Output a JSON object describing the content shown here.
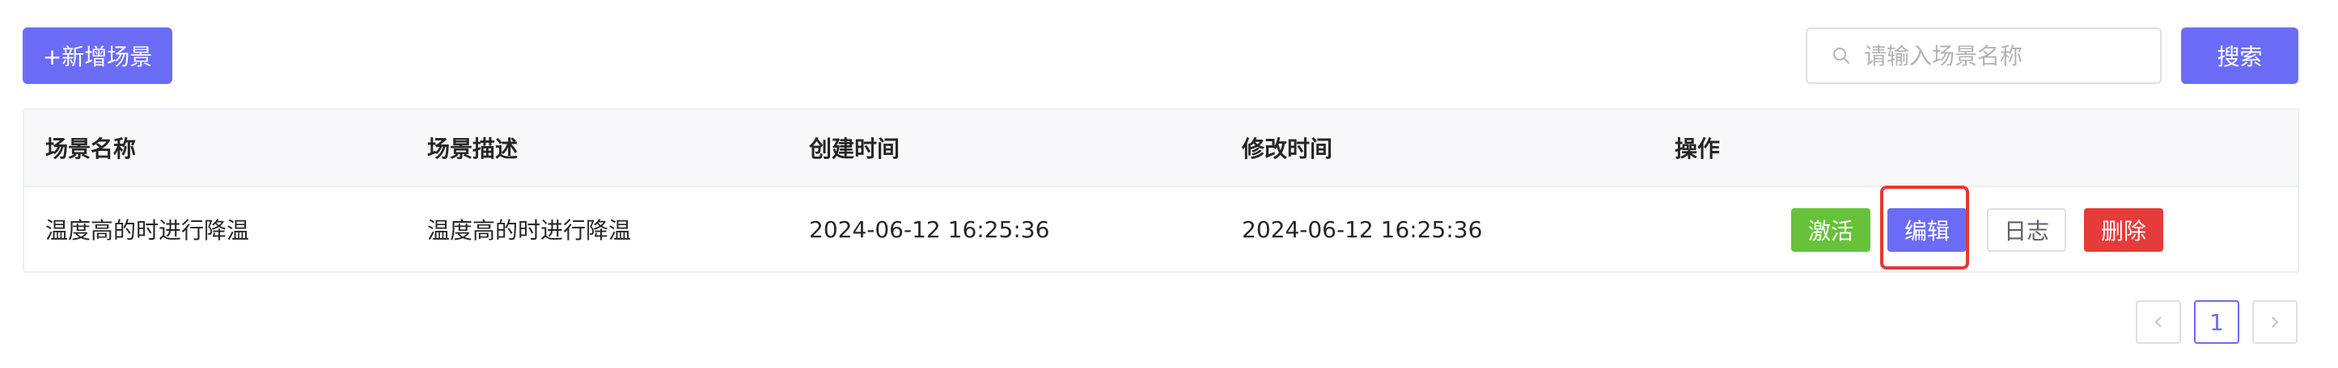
{
  "toolbar": {
    "add_label": "+新增场景",
    "search_placeholder": "请输入场景名称",
    "search_value": "",
    "search_button_label": "搜索"
  },
  "table": {
    "headers": [
      "场景名称",
      "场景描述",
      "创建时间",
      "修改时间",
      "操作"
    ],
    "rows": [
      {
        "name": "温度高的时进行降温",
        "description": "温度高的时进行降温",
        "created": "2024-06-12 16:25:36",
        "modified": "2024-06-12 16:25:36",
        "actions": {
          "activate": "激活",
          "edit": "编辑",
          "log": "日志",
          "delete": "删除"
        }
      }
    ]
  },
  "pagination": {
    "current_page": "1",
    "prev_icon": "chevron-left-icon",
    "next_icon": "chevron-right-icon"
  },
  "colors": {
    "primary": "#6b6cf5",
    "success": "#67c23a",
    "danger": "#e53b3b",
    "highlight": "#e33a2e"
  }
}
